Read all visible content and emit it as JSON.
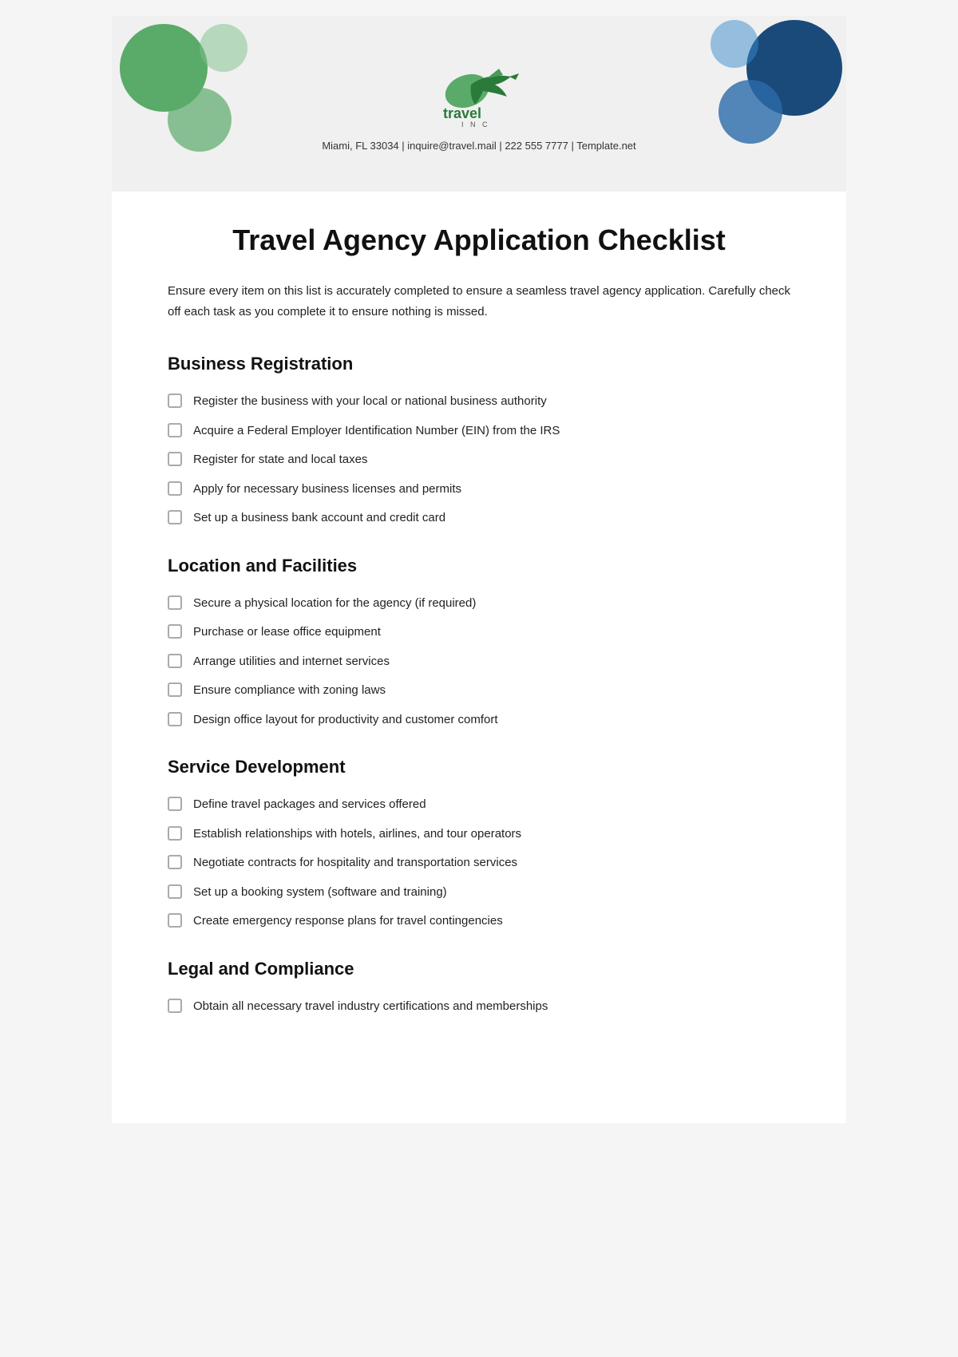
{
  "header": {
    "logo_text": "travel INC",
    "contact": "Miami, FL 33034 | inquire@travel.mail | 222 555 7777 | Template.net"
  },
  "main_title": "Travel Agency Application Checklist",
  "intro": "Ensure every item on this list is accurately completed to ensure a seamless travel agency application. Carefully check off each task as you complete it to ensure nothing is missed.",
  "sections": [
    {
      "title": "Business Registration",
      "items": [
        "Register the business with your local or national business authority",
        "Acquire a Federal Employer Identification Number (EIN) from the IRS",
        "Register for state and local taxes",
        "Apply for necessary business licenses and permits",
        "Set up a business bank account and credit card"
      ]
    },
    {
      "title": "Location and Facilities",
      "items": [
        "Secure a physical location for the agency (if required)",
        "Purchase or lease office equipment",
        "Arrange utilities and internet services",
        "Ensure compliance with zoning laws",
        "Design office layout for productivity and customer comfort"
      ]
    },
    {
      "title": "Service Development",
      "items": [
        "Define travel packages and services offered",
        "Establish relationships with hotels, airlines, and tour operators",
        "Negotiate contracts for hospitality and transportation services",
        "Set up a booking system (software and training)",
        "Create emergency response plans for travel contingencies"
      ]
    },
    {
      "title": "Legal and Compliance",
      "items": [
        "Obtain all necessary travel industry certifications and memberships"
      ]
    }
  ]
}
